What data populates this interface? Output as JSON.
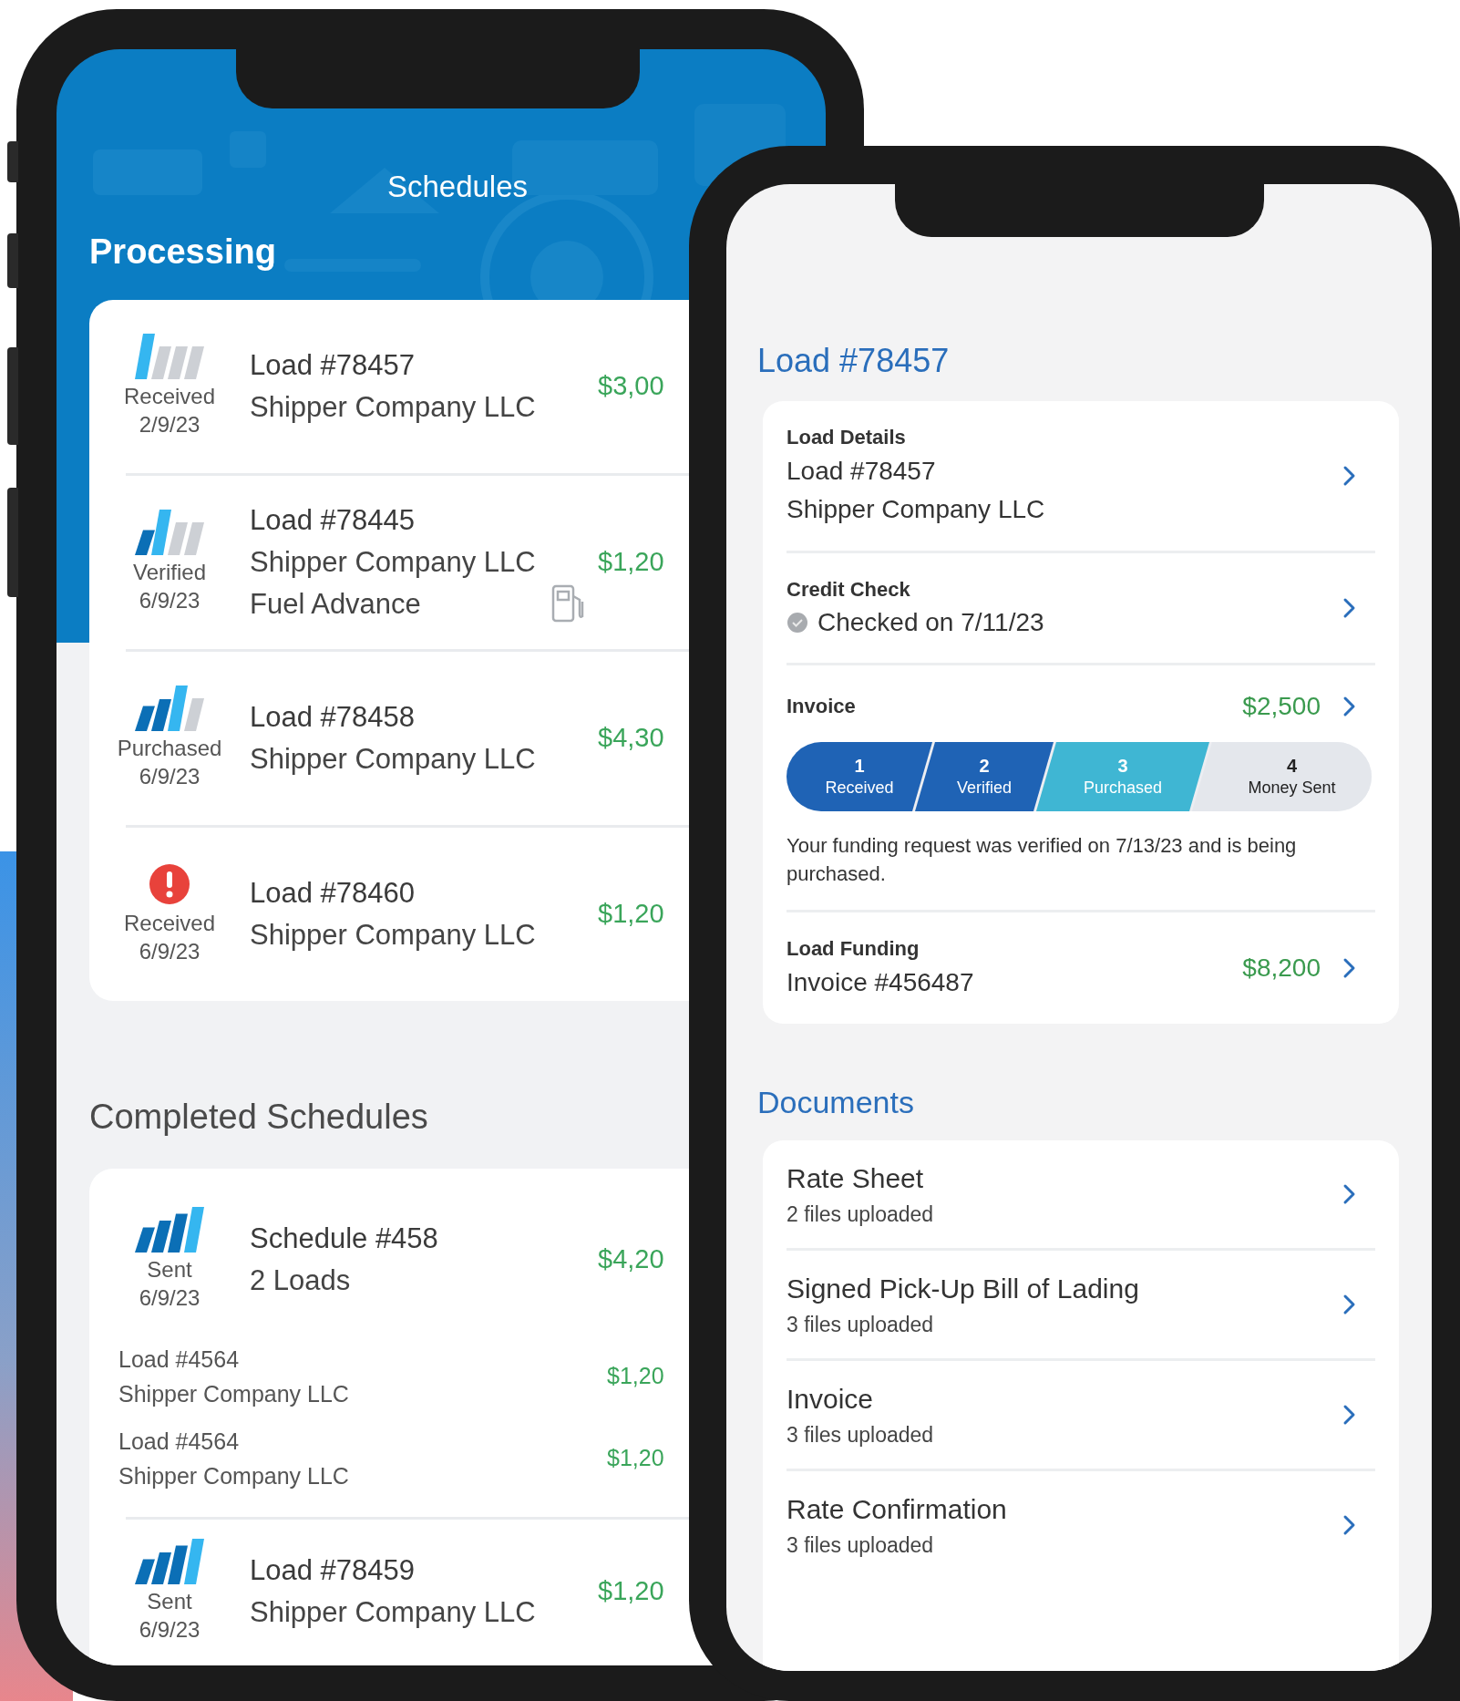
{
  "schedules_screen": {
    "title": "Schedules",
    "processing": {
      "heading": "Processing",
      "rows": [
        {
          "kind": "progress",
          "bars": [
            {
              "filled": true
            },
            {
              "filled": false
            },
            {
              "filled": false
            },
            {
              "filled": false
            }
          ],
          "status": "Received",
          "date": "2/9/23",
          "lines": [
            "Load #78457",
            "Shipper Company LLC"
          ],
          "amount": "$3,00",
          "fuel": false
        },
        {
          "kind": "progress",
          "bars": [
            {
              "filled": true
            },
            {
              "filled": true
            },
            {
              "filled": false
            },
            {
              "filled": false
            }
          ],
          "status": "Verified",
          "date": "6/9/23",
          "lines": [
            "Load #78445",
            "Shipper Company LLC",
            "Fuel Advance"
          ],
          "amount": "$1,20",
          "fuel": true
        },
        {
          "kind": "progress",
          "bars": [
            {
              "filled": true
            },
            {
              "filled": true
            },
            {
              "filled": true
            },
            {
              "filled": false
            }
          ],
          "status": "Purchased",
          "date": "6/9/23",
          "lines": [
            "Load #78458",
            "Shipper Company LLC"
          ],
          "amount": "$4,30",
          "fuel": false
        },
        {
          "kind": "alert",
          "status": "Received",
          "date": "6/9/23",
          "lines": [
            "Load #78460",
            "Shipper Company LLC"
          ],
          "amount": "$1,20",
          "fuel": false
        }
      ]
    },
    "completed": {
      "heading": "Completed Schedules",
      "rows": [
        {
          "kind": "progress",
          "bars": [
            {
              "filled": true
            },
            {
              "filled": true
            },
            {
              "filled": true
            },
            {
              "filled": true
            }
          ],
          "status": "Sent",
          "date": "6/9/23",
          "lines": [
            "Schedule #458",
            "2 Loads"
          ],
          "amount": "$4,20",
          "loads": [
            {
              "lines": [
                "Load #4564",
                "Shipper Company LLC"
              ],
              "amount": "$1,20"
            },
            {
              "lines": [
                "Load #4564",
                "Shipper Company LLC"
              ],
              "amount": "$1,20"
            }
          ]
        },
        {
          "kind": "progress",
          "bars": [
            {
              "filled": true
            },
            {
              "filled": true
            },
            {
              "filled": true
            },
            {
              "filled": true
            }
          ],
          "status": "Sent",
          "date": "6/9/23",
          "lines": [
            "Load #78459",
            "Shipper Company LLC"
          ],
          "amount": "$1,20"
        }
      ]
    }
  },
  "load_screen": {
    "title": "Load #78457",
    "sections": [
      {
        "kind": "text",
        "label": "Load Details",
        "lines": [
          "Load #78457",
          "Shipper Company LLC"
        ]
      },
      {
        "kind": "check",
        "label": "Credit Check",
        "lines": [
          "Checked on 7/11/23"
        ]
      },
      {
        "kind": "progress",
        "label": "Invoice",
        "amount": "$2,500",
        "steps": [
          {
            "number": "1",
            "label": "Received",
            "done": true,
            "current": false
          },
          {
            "number": "2",
            "label": "Verified",
            "done": true,
            "current": false
          },
          {
            "number": "3",
            "label": "Purchased",
            "done": false,
            "current": true
          },
          {
            "number": "4",
            "label": "Money Sent",
            "done": false,
            "current": false
          }
        ],
        "note": "Your funding request was verified on 7/13/23 and is being purchased."
      },
      {
        "kind": "text",
        "label": "Load Funding",
        "lines": [
          "Invoice #456487"
        ],
        "amount": "$8,200"
      }
    ],
    "documents": {
      "heading": "Documents",
      "items": [
        {
          "name": "Rate Sheet",
          "files": "2 files uploaded"
        },
        {
          "name": "Signed Pick-Up Bill of Lading",
          "files": "3 files uploaded"
        },
        {
          "name": "Invoice",
          "files": "3 files uploaded"
        },
        {
          "name": "Rate Confirmation",
          "files": "3 files uploaded"
        }
      ]
    }
  }
}
